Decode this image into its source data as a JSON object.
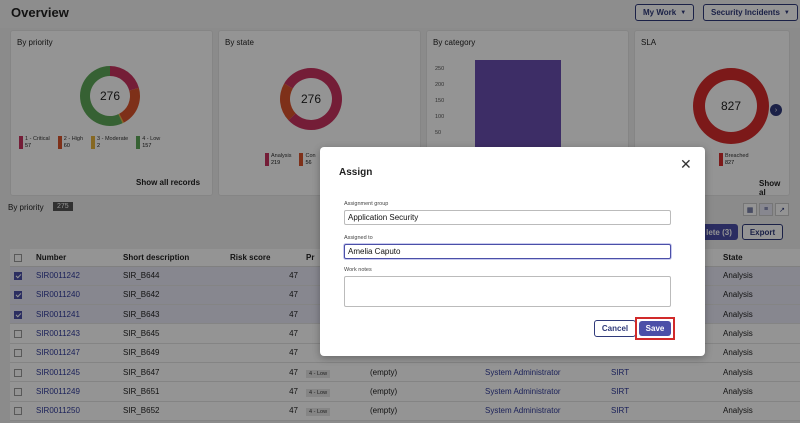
{
  "header": {
    "title": "Overview",
    "my_work": "My Work",
    "incidents": "Security Incidents"
  },
  "cards": {
    "priority": {
      "title": "By priority",
      "total": "276",
      "legend": [
        {
          "label": "1 - Critical",
          "value": "57",
          "color": "#c8335f"
        },
        {
          "label": "2 - High",
          "value": "60",
          "color": "#d9542b"
        },
        {
          "label": "3 - Moderate",
          "value": "2",
          "color": "#e7b43b"
        },
        {
          "label": "4 - Low",
          "value": "157",
          "color": "#5da858"
        }
      ],
      "show_all": "Show all records"
    },
    "state": {
      "title": "By state",
      "total": "276",
      "legend": [
        {
          "label": "Analysis",
          "value": "219",
          "color": "#c8335f"
        },
        {
          "label": "Con",
          "value": "56",
          "color": "#d9542b"
        }
      ]
    },
    "category": {
      "title": "By category",
      "yticks": [
        "250",
        "200",
        "150",
        "100",
        "50"
      ]
    },
    "sla": {
      "title": "SLA",
      "total": "827",
      "legend": [
        {
          "label": "Breached",
          "value": "827",
          "color": "#d62b2b"
        }
      ],
      "show_all": "Show al"
    }
  },
  "chart_data": [
    {
      "type": "pie",
      "title": "By priority",
      "categories": [
        "1 - Critical",
        "2 - High",
        "3 - Moderate",
        "4 - Low"
      ],
      "values": [
        57,
        60,
        2,
        157
      ]
    },
    {
      "type": "pie",
      "title": "By state",
      "categories": [
        "Analysis",
        "Con"
      ],
      "values": [
        219,
        56
      ]
    },
    {
      "type": "bar",
      "title": "By category",
      "categories": [
        ""
      ],
      "values": [
        275
      ],
      "ylim": [
        0,
        275
      ]
    },
    {
      "type": "pie",
      "title": "SLA",
      "categories": [
        "Breached"
      ],
      "values": [
        827
      ]
    }
  ],
  "list": {
    "label": "By priority",
    "count": "275",
    "delete_label": "lete (3)",
    "export_label": "Export",
    "columns": [
      "Number",
      "Short description",
      "Risk score",
      "Pr",
      "State"
    ],
    "rows": [
      {
        "number": "SIR0011242",
        "desc": "SIR_B644",
        "risk": "47",
        "pri": "",
        "assign": "",
        "group": "",
        "sg": "",
        "state": "Analysis",
        "selected": true
      },
      {
        "number": "SIR0011240",
        "desc": "SIR_B642",
        "risk": "47",
        "pri": "",
        "assign": "",
        "group": "",
        "sg": "",
        "state": "Analysis",
        "selected": true
      },
      {
        "number": "SIR0011241",
        "desc": "SIR_B643",
        "risk": "47",
        "pri": "",
        "assign": "",
        "group": "",
        "sg": "",
        "state": "Analysis",
        "selected": true
      },
      {
        "number": "SIR0011243",
        "desc": "SIR_B645",
        "risk": "47",
        "pri": "",
        "assign": "",
        "group": "",
        "sg": "",
        "state": "Analysis",
        "selected": false
      },
      {
        "number": "SIR0011247",
        "desc": "SIR_B649",
        "risk": "47",
        "pri": "",
        "assign": "",
        "group": "",
        "sg": "",
        "state": "Analysis",
        "selected": false
      },
      {
        "number": "SIR0011245",
        "desc": "SIR_B647",
        "risk": "47",
        "pri": "4 - Low",
        "assign": "(empty)",
        "group": "System Administrator",
        "sg": "SIRT",
        "state": "Analysis",
        "selected": false
      },
      {
        "number": "SIR0011249",
        "desc": "SIR_B651",
        "risk": "47",
        "pri": "4 - Low",
        "assign": "(empty)",
        "group": "System Administrator",
        "sg": "SIRT",
        "state": "Analysis",
        "selected": false
      },
      {
        "number": "SIR0011250",
        "desc": "SIR_B652",
        "risk": "47",
        "pri": "4 - Low",
        "assign": "(empty)",
        "group": "System Administrator",
        "sg": "SIRT",
        "state": "Analysis",
        "selected": false
      }
    ]
  },
  "modal": {
    "title": "Assign",
    "group_label": "Assignment group",
    "group_value": "Application Security",
    "assigned_label": "Assigned to",
    "assigned_value": "Amelia Caputo",
    "notes_label": "Work notes",
    "notes_value": "",
    "cancel": "Cancel",
    "save": "Save"
  }
}
